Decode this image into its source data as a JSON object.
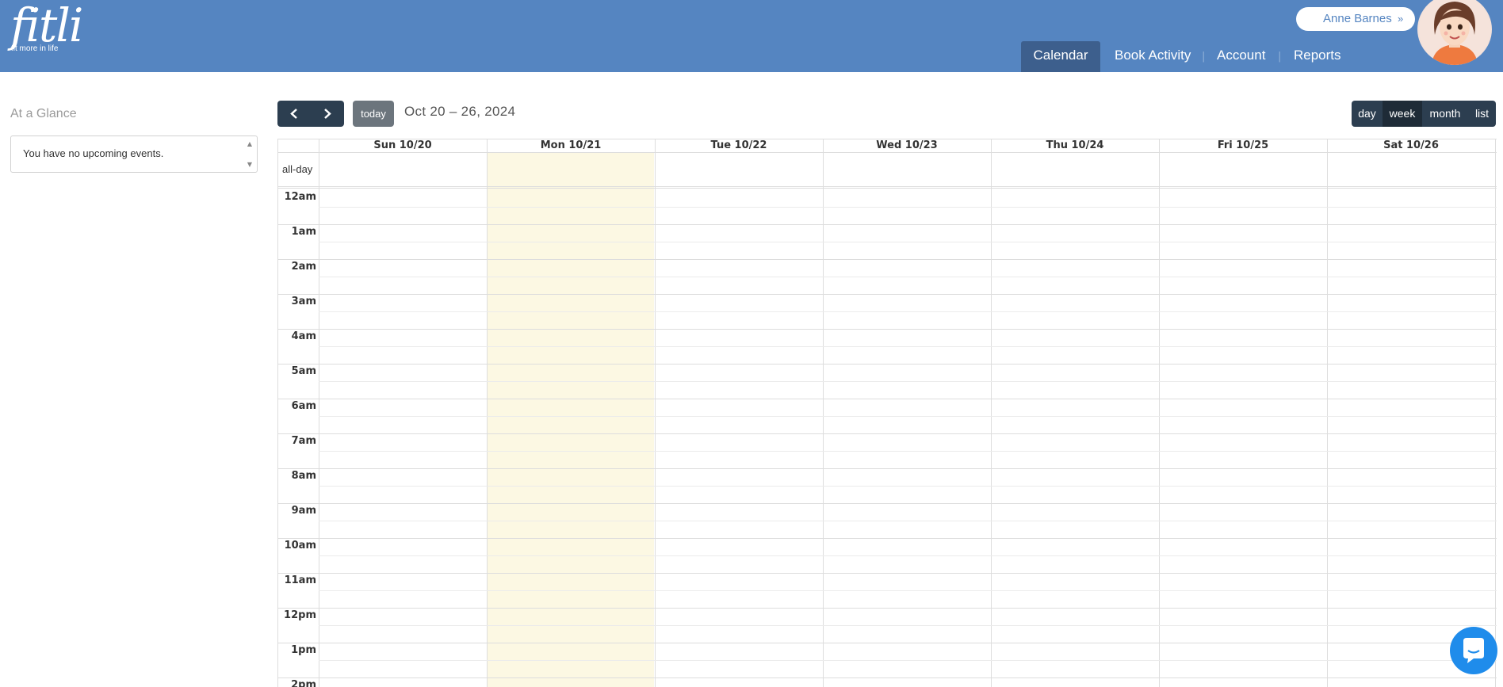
{
  "header": {
    "logo_word": "fitli",
    "logo_tagline": "fit more in life",
    "user_name": "Anne Barnes",
    "user_chevron": "»",
    "nav": [
      {
        "label": "Calendar",
        "active": true
      },
      {
        "label": "Book Activity",
        "active": false
      },
      {
        "label": "Account",
        "active": false
      },
      {
        "label": "Reports",
        "active": false
      }
    ],
    "separator": "|",
    "colors": {
      "header_bg": "#5585c1",
      "active_tab": "#3d5f8d"
    }
  },
  "sidebar": {
    "title": "At a Glance",
    "empty_message": "You have no upcoming events.",
    "scroll_up_icon": "▲",
    "scroll_down_icon": "▼"
  },
  "toolbar": {
    "prev_icon": "<",
    "next_icon": ">",
    "today_label": "today",
    "range_title": "Oct 20 – 26, 2024",
    "views": [
      {
        "label": "day",
        "active": false
      },
      {
        "label": "week",
        "active": true
      },
      {
        "label": "month",
        "active": false
      },
      {
        "label": "list",
        "active": false
      }
    ]
  },
  "calendar": {
    "allday_label": "all-day",
    "days": [
      "Sun 10/20",
      "Mon 10/21",
      "Tue 10/22",
      "Wed 10/23",
      "Thu 10/24",
      "Fri 10/25",
      "Sat 10/26"
    ],
    "today_index": 1,
    "today_color": "#fcf8e3",
    "hours": [
      "12am",
      "1am",
      "2am",
      "3am",
      "4am",
      "5am",
      "6am",
      "7am",
      "8am",
      "9am",
      "10am",
      "11am",
      "12pm",
      "1pm",
      "2pm"
    ]
  },
  "chat": {
    "icon": "chat-bubble-icon",
    "color": "#1f8ceb"
  }
}
